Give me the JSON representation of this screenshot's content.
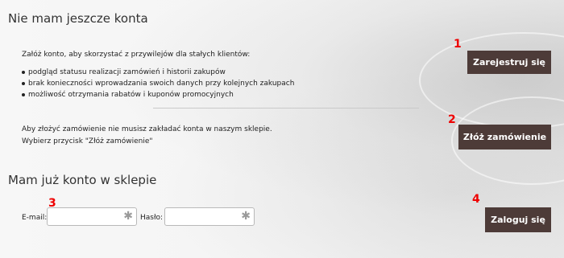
{
  "new_account": {
    "heading": "Nie mam jeszcze konta",
    "intro": "Załóż konto, aby skorzystać z przywilejów dla stałych klientów:",
    "benefits": [
      "podgląd statusu realizacji zamówień i historii zakupów",
      "brak konieczności wprowadzania swoich danych przy kolejnych zakupach",
      "możliwość otrzymania rabatów i kuponów promocyjnych"
    ],
    "register_button": "Zarejestruj się",
    "guest_line1": "Aby złożyć zamówienie nie musisz zakładać konta w naszym sklepie.",
    "guest_line2": "Wybierz przycisk \"Złóż zamówienie\"",
    "order_button": "Złóż zamówienie"
  },
  "login": {
    "heading": "Mam już konto w sklepie",
    "email_label": "E-mail:",
    "email_value": "",
    "password_label": "Hasło:",
    "password_value": "",
    "required_mark": "✱",
    "login_button": "Zaloguj się"
  },
  "annotations": [
    "1",
    "2",
    "3",
    "4"
  ],
  "colors": {
    "button_bg": "#4d3b38",
    "annotation": "#e00000"
  }
}
